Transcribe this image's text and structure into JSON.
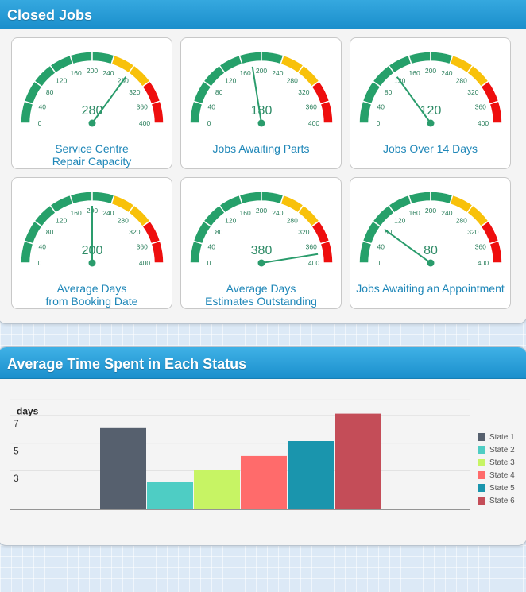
{
  "closed_jobs": {
    "title": "Closed Jobs",
    "scale": {
      "min": 0,
      "max": 400,
      "ticks": [
        "0",
        "40",
        "80",
        "120",
        "160",
        "200",
        "240",
        "280",
        "320",
        "360",
        "400"
      ]
    },
    "band_colors": {
      "green": "#26a06a",
      "amber": "#f8c10a",
      "red": "#ee0e0e",
      "needle": "#2a9c6c",
      "label": "#1f87b8"
    },
    "gauges": [
      {
        "label_lines": [
          "Service Centre",
          "Repair Capacity"
        ],
        "value": 280,
        "value_text": "280"
      },
      {
        "label_lines": [
          "Jobs Awaiting Parts"
        ],
        "value": 180,
        "value_text": "180"
      },
      {
        "label_lines": [
          "Jobs Over 14 Days"
        ],
        "value": 120,
        "value_text": "120"
      },
      {
        "label_lines": [
          "Average Days",
          "from Booking Date"
        ],
        "value": 200,
        "value_text": "200"
      },
      {
        "label_lines": [
          "Average Days",
          "Estimates Outstanding"
        ],
        "value": 380,
        "value_text": "380"
      },
      {
        "label_lines": [
          "Jobs Awaiting an Appointment"
        ],
        "value": 80,
        "value_text": "80"
      }
    ]
  },
  "avg_time": {
    "title": "Average Time Spent in Each Status"
  },
  "chart_data": {
    "type": "bar",
    "title": "",
    "ylabel": "days",
    "xlabel": "",
    "ylim": [
      1.1,
      9.1
    ],
    "yticks": [
      "3",
      "5",
      "7"
    ],
    "grid": true,
    "legend_position": "right",
    "series": [
      {
        "name": "State 1",
        "value": 7.1,
        "color": "#56606e"
      },
      {
        "name": "State 2",
        "value": 3.1,
        "color": "#4ecdc4"
      },
      {
        "name": "State 3",
        "value": 4.0,
        "color": "#c7f464"
      },
      {
        "name": "State 4",
        "value": 5.0,
        "color": "#ff6b6b"
      },
      {
        "name": "State 5",
        "value": 6.1,
        "color": "#1a95ad"
      },
      {
        "name": "State 6",
        "value": 8.1,
        "color": "#c44d58"
      }
    ]
  }
}
